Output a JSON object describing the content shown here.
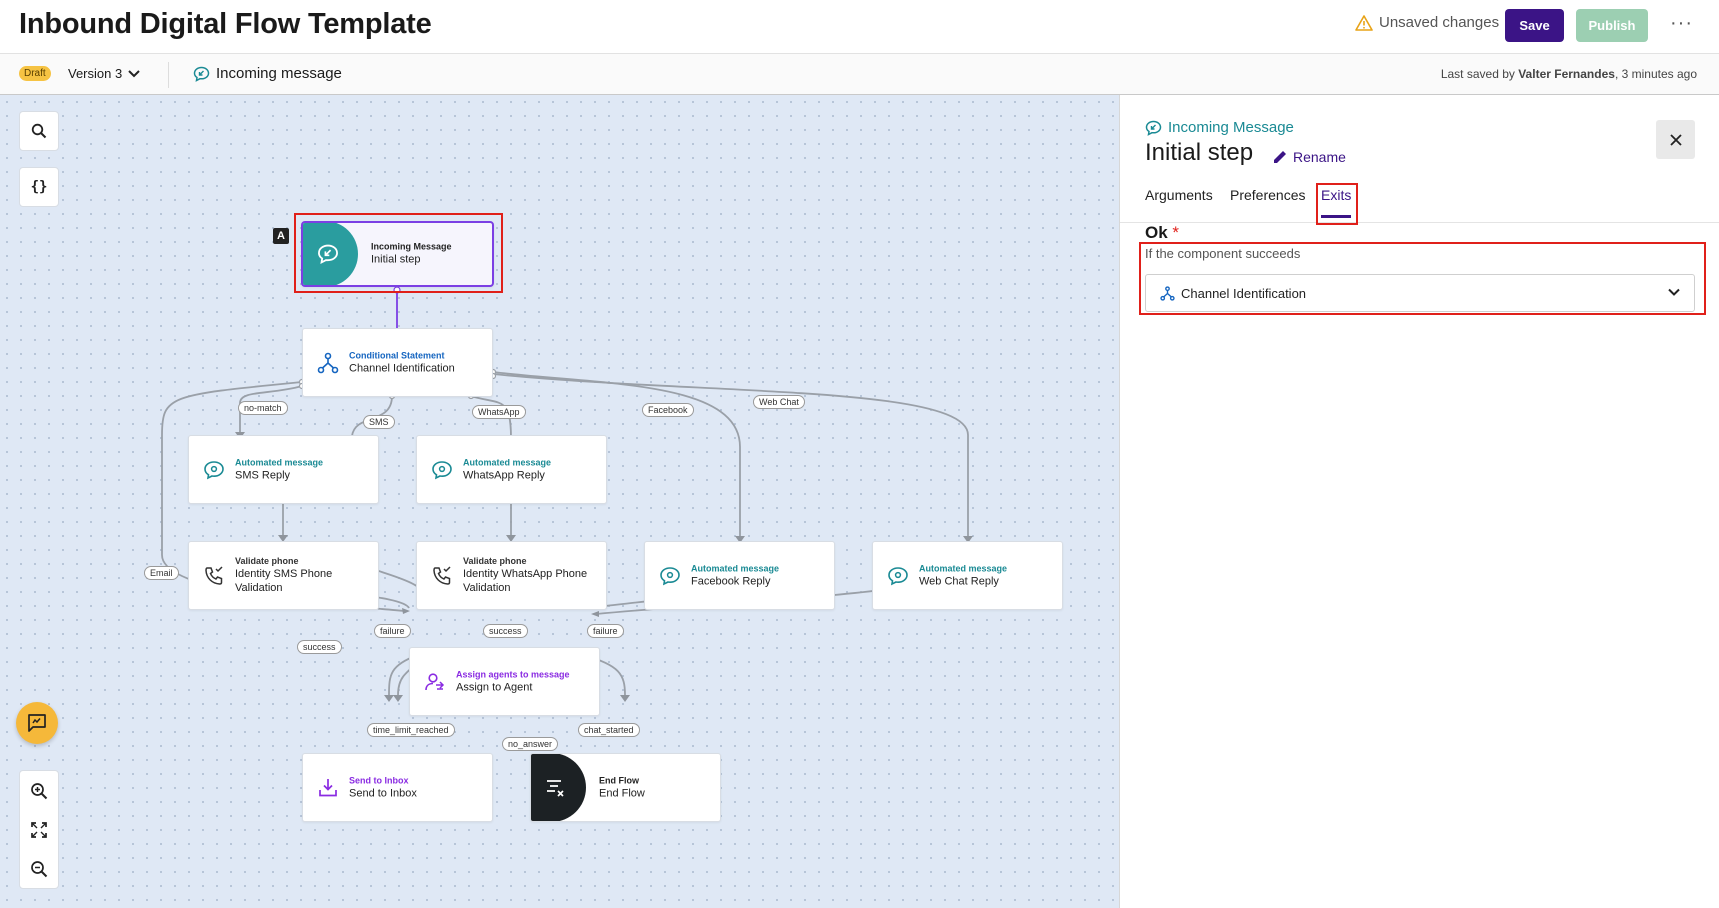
{
  "header": {
    "title": "Inbound Digital Flow Template",
    "unsaved": "Unsaved changes",
    "save_label": "Save",
    "publish_label": "Publish",
    "more_label": "···"
  },
  "subheader": {
    "status_badge": "Draft",
    "version": "Version 3",
    "trigger_label": "Incoming message",
    "last_saved_prefix": "Last saved by ",
    "last_saved_user": "Valter Fernandes",
    "last_saved_suffix": ", 3 minutes ago"
  },
  "canvas": {
    "start_marker": "A",
    "nodes": {
      "initial": {
        "type": "Incoming Message",
        "label": "Initial step"
      },
      "channel": {
        "type": "Conditional Statement",
        "label": "Channel Identification"
      },
      "sms_reply": {
        "type": "Automated message",
        "label": "SMS Reply"
      },
      "whatsapp_reply": {
        "type": "Automated message",
        "label": "WhatsApp Reply"
      },
      "sms_validate": {
        "type": "Validate phone",
        "label": "Identity SMS Phone Validation"
      },
      "wa_validate": {
        "type": "Validate phone",
        "label": "Identity WhatsApp Phone Validation"
      },
      "facebook_reply": {
        "type": "Automated message",
        "label": "Facebook Reply"
      },
      "webchat_reply": {
        "type": "Automated message",
        "label": "Web Chat Reply"
      },
      "assign": {
        "type": "Assign agents to message",
        "label": "Assign to Agent"
      },
      "inbox": {
        "type": "Send to Inbox",
        "label": "Send to Inbox"
      },
      "end": {
        "type": "End Flow",
        "label": "End Flow"
      }
    },
    "edge_labels": {
      "no_match": "no-match",
      "sms": "SMS",
      "whatsapp": "WhatsApp",
      "facebook": "Facebook",
      "web_chat": "Web Chat",
      "email": "Email",
      "success1": "success",
      "failure1": "failure",
      "success2": "success",
      "failure2": "failure",
      "time_limit": "time_limit_reached",
      "no_answer": "no_answer",
      "chat_started": "chat_started"
    }
  },
  "panel": {
    "component_type": "Incoming Message",
    "step_title": "Initial step",
    "rename_label": "Rename",
    "tabs": [
      "Arguments",
      "Preferences",
      "Exits"
    ],
    "active_tab": "Exits",
    "exit": {
      "name": "Ok",
      "required_mark": "*",
      "description": "If the component succeeds",
      "selected_value": "Channel Identification"
    }
  },
  "colors": {
    "brand_purple": "#3b1486",
    "teal": "#1a8a94",
    "highlight_red": "#e0201a",
    "draft_yellow": "#f6c343"
  }
}
